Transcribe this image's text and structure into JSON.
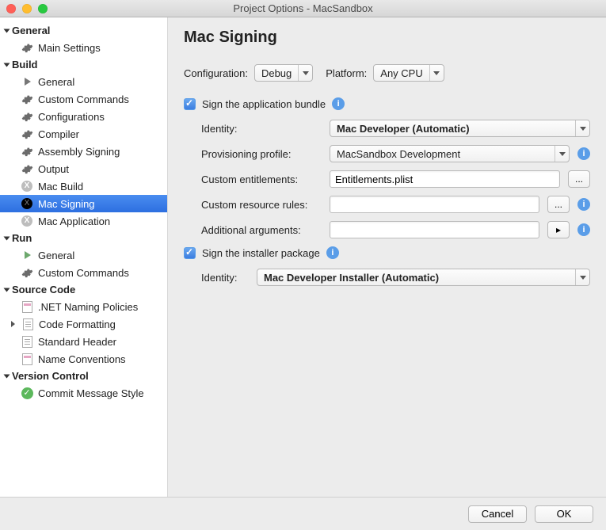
{
  "window_title": "Project Options - MacSandbox",
  "sidebar": {
    "sections": [
      {
        "label": "General",
        "items": [
          {
            "label": "Main Settings",
            "icon": "gear"
          }
        ]
      },
      {
        "label": "Build",
        "items": [
          {
            "label": "General",
            "icon": "play"
          },
          {
            "label": "Custom Commands",
            "icon": "gear"
          },
          {
            "label": "Configurations",
            "icon": "gear"
          },
          {
            "label": "Compiler",
            "icon": "gear"
          },
          {
            "label": "Assembly Signing",
            "icon": "gear"
          },
          {
            "label": "Output",
            "icon": "gear"
          },
          {
            "label": "Mac Build",
            "icon": "xcirc"
          },
          {
            "label": "Mac Signing",
            "icon": "xcirc",
            "selected": true
          },
          {
            "label": "Mac Application",
            "icon": "xcirc"
          }
        ]
      },
      {
        "label": "Run",
        "items": [
          {
            "label": "General",
            "icon": "play-green"
          },
          {
            "label": "Custom Commands",
            "icon": "gear"
          }
        ]
      },
      {
        "label": "Source Code",
        "items": [
          {
            "label": ".NET Naming Policies",
            "icon": "page-pink"
          },
          {
            "label": "Code Formatting",
            "icon": "page-lines",
            "expandable": true
          },
          {
            "label": "Standard Header",
            "icon": "page-lines"
          },
          {
            "label": "Name Conventions",
            "icon": "page-pink"
          }
        ]
      },
      {
        "label": "Version Control",
        "items": [
          {
            "label": "Commit Message Style",
            "icon": "check"
          }
        ]
      }
    ]
  },
  "main": {
    "title": "Mac Signing",
    "config_label": "Configuration:",
    "config_value": "Debug",
    "platform_label": "Platform:",
    "platform_value": "Any CPU",
    "sign_app_label": "Sign the application bundle",
    "fields": {
      "identity_label": "Identity:",
      "identity_value": "Mac Developer (Automatic)",
      "prov_label": "Provisioning profile:",
      "prov_value": "MacSandbox Development",
      "ent_label": "Custom entitlements:",
      "ent_value": "Entitlements.plist",
      "res_label": "Custom resource rules:",
      "res_value": "",
      "args_label": "Additional arguments:",
      "args_value": ""
    },
    "sign_pkg_label": "Sign the installer package",
    "pkg_identity_label": "Identity:",
    "pkg_identity_value": "Mac Developer Installer (Automatic)"
  },
  "buttons": {
    "cancel": "Cancel",
    "ok": "OK",
    "browse": "..."
  }
}
